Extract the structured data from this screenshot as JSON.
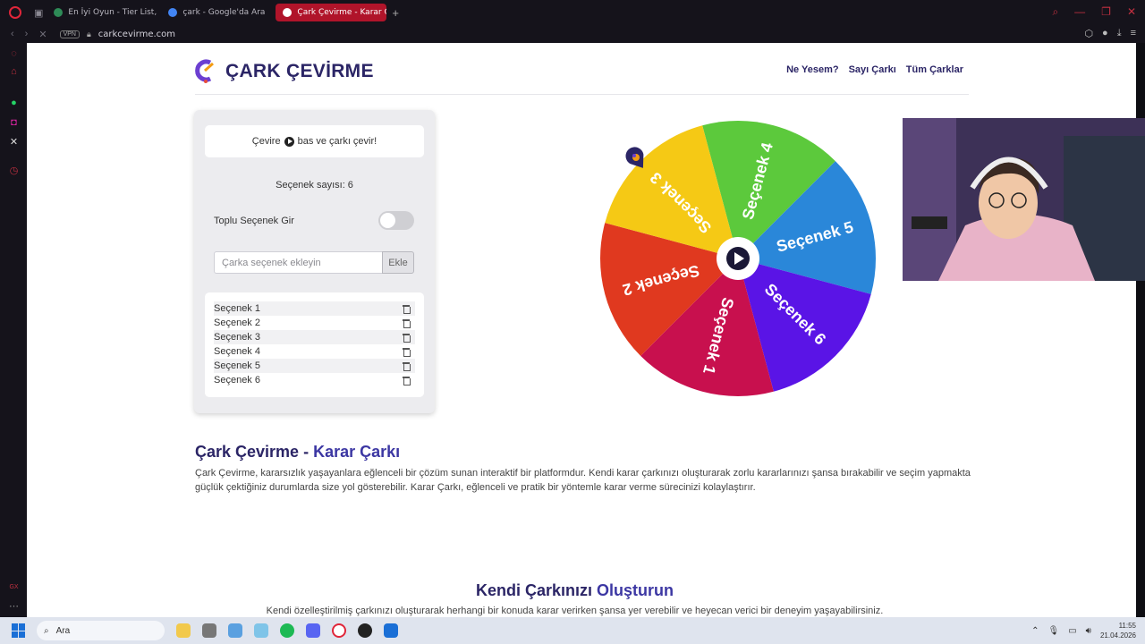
{
  "browser": {
    "tabs": [
      {
        "title": "En İyi Oyun - Tier List, Kör",
        "fav_color": "#2e8b57"
      },
      {
        "title": "çark - Google'da Ara",
        "fav_color": "#4285f4"
      },
      {
        "title": "Çark Çevirme - Karar Çark",
        "fav_color": "#e0263a",
        "active": true
      }
    ],
    "url": "carkcevirme.com",
    "vpn": "VPN"
  },
  "site": {
    "logo_text": "ÇARK ÇEVİRME",
    "nav": [
      "Ne Yesem?",
      "Sayı Çarkı",
      "Tüm Çarklar"
    ]
  },
  "panel": {
    "hint_before": "Çevire",
    "hint_after": "bas ve çarkı çevir!",
    "count_label": "Seçenek sayısı:",
    "count_value": "6",
    "bulk_label": "Toplu Seçenek Gir",
    "input_placeholder": "Çarka seçenek ekleyin",
    "add_label": "Ekle",
    "options": [
      "Seçenek 1",
      "Seçenek 2",
      "Seçenek 3",
      "Seçenek 4",
      "Seçenek 5",
      "Seçenek 6"
    ]
  },
  "wheel": {
    "segments": [
      {
        "label": "Seçenek 4",
        "color": "#5cc93c"
      },
      {
        "label": "Seçenek 5",
        "color": "#2a87d9"
      },
      {
        "label": "Seçenek 6",
        "color": "#5a14e6"
      },
      {
        "label": "Seçenek 1",
        "color": "#c8104e"
      },
      {
        "label": "Seçenek 2",
        "color": "#e0391f"
      },
      {
        "label": "Seçenek 3",
        "color": "#f5c915"
      }
    ]
  },
  "content": {
    "title_a": "Çark Çevirme - ",
    "title_b": "Karar Çarkı",
    "description": "Çark Çevirme, kararsızlık yaşayanlara eğlenceli bir çözüm sunan interaktif bir platformdur. Kendi karar çarkınızı oluşturarak zorlu kararlarınızı şansa bırakabilir ve seçim yapmakta güçlük çektiğiniz durumlarda size yol gösterebilir. Karar Çarkı, eğlenceli ve pratik bir yöntemle karar verme sürecinizi kolaylaştırır.",
    "sub_title_a": "Kendi Çarkınızı ",
    "sub_title_b": "Oluşturun",
    "sub_description": "Kendi özelleştirilmiş çarkınızı oluşturarak herhangi bir konuda karar verirken şansa yer verebilir ve heyecan verici bir deneyim yaşayabilirsiniz."
  },
  "taskbar": {
    "search_placeholder": "Ara",
    "time": "11:55",
    "date": "21.04.2026"
  },
  "icons": {
    "play": "play-icon",
    "trash": "trash-icon",
    "search": "search-icon"
  },
  "colors": {
    "brand": "#2b2566",
    "accent": "#3c37a3",
    "opera_red": "#e0263a"
  }
}
